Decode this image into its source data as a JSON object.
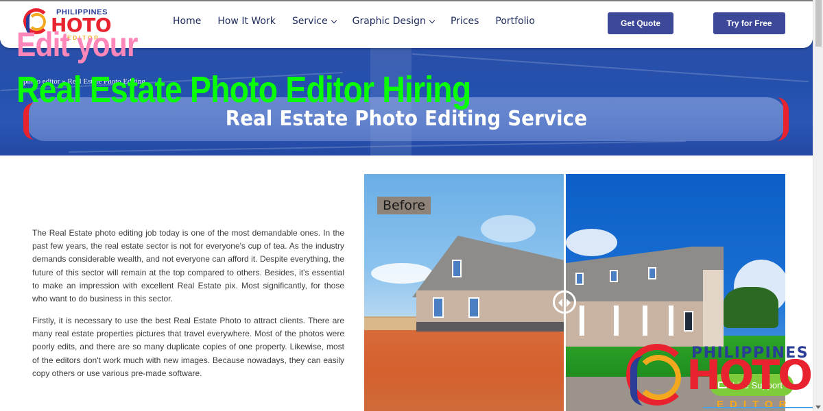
{
  "header": {
    "logo": {
      "top": "PHILIPPINES",
      "main": "HOTO",
      "sub": "EDITOR"
    },
    "nav": [
      {
        "label": "Home",
        "has_dropdown": false
      },
      {
        "label": "How It Work",
        "has_dropdown": false
      },
      {
        "label": "Service",
        "has_dropdown": true
      },
      {
        "label": "Graphic Design",
        "has_dropdown": true
      },
      {
        "label": "Prices",
        "has_dropdown": false
      },
      {
        "label": "Portfolio",
        "has_dropdown": false
      }
    ],
    "buttons": {
      "quote": "Get Quote",
      "free": "Try for Free"
    },
    "accent": "#3d4898"
  },
  "overlay": {
    "line1": "Edit your",
    "line2": "Real Estate Photo Editor Hiring"
  },
  "banner": {
    "breadcrumb": "photo editor » Real Estate Photo Editing",
    "title": "Real Estate Photo Editing Service"
  },
  "content": {
    "paragraphs": [
      "The Real Estate photo editing job today is one of the most demandable ones. In the past few years, the real estate sector is not for everyone's cup of tea. As the industry demands considerable wealth, and not everyone can afford it. Despite everything, the future of this sector will remain at the top compared to others. Besides, it's essential to make an impression with excellent Real Estate pix. Most significantly, for those who want to do business in this sector.",
      "Firstly, it is necessary to use the best Real Estate Photo to attract clients. There are many real estate properties pictures that travel everywhere. Most of the photos were poorly edits, and there are so many duplicate copies of one property. Likewise, most of the editors don't work much with new images. Because nowadays, they can easily copy others or use various pre-made software."
    ]
  },
  "comparison": {
    "before_label": "Before"
  },
  "floating_logo": {
    "top": "PHILIPPINES",
    "main": "HOTO",
    "sub": "EDITOR"
  },
  "support": {
    "label": "Live Support"
  }
}
